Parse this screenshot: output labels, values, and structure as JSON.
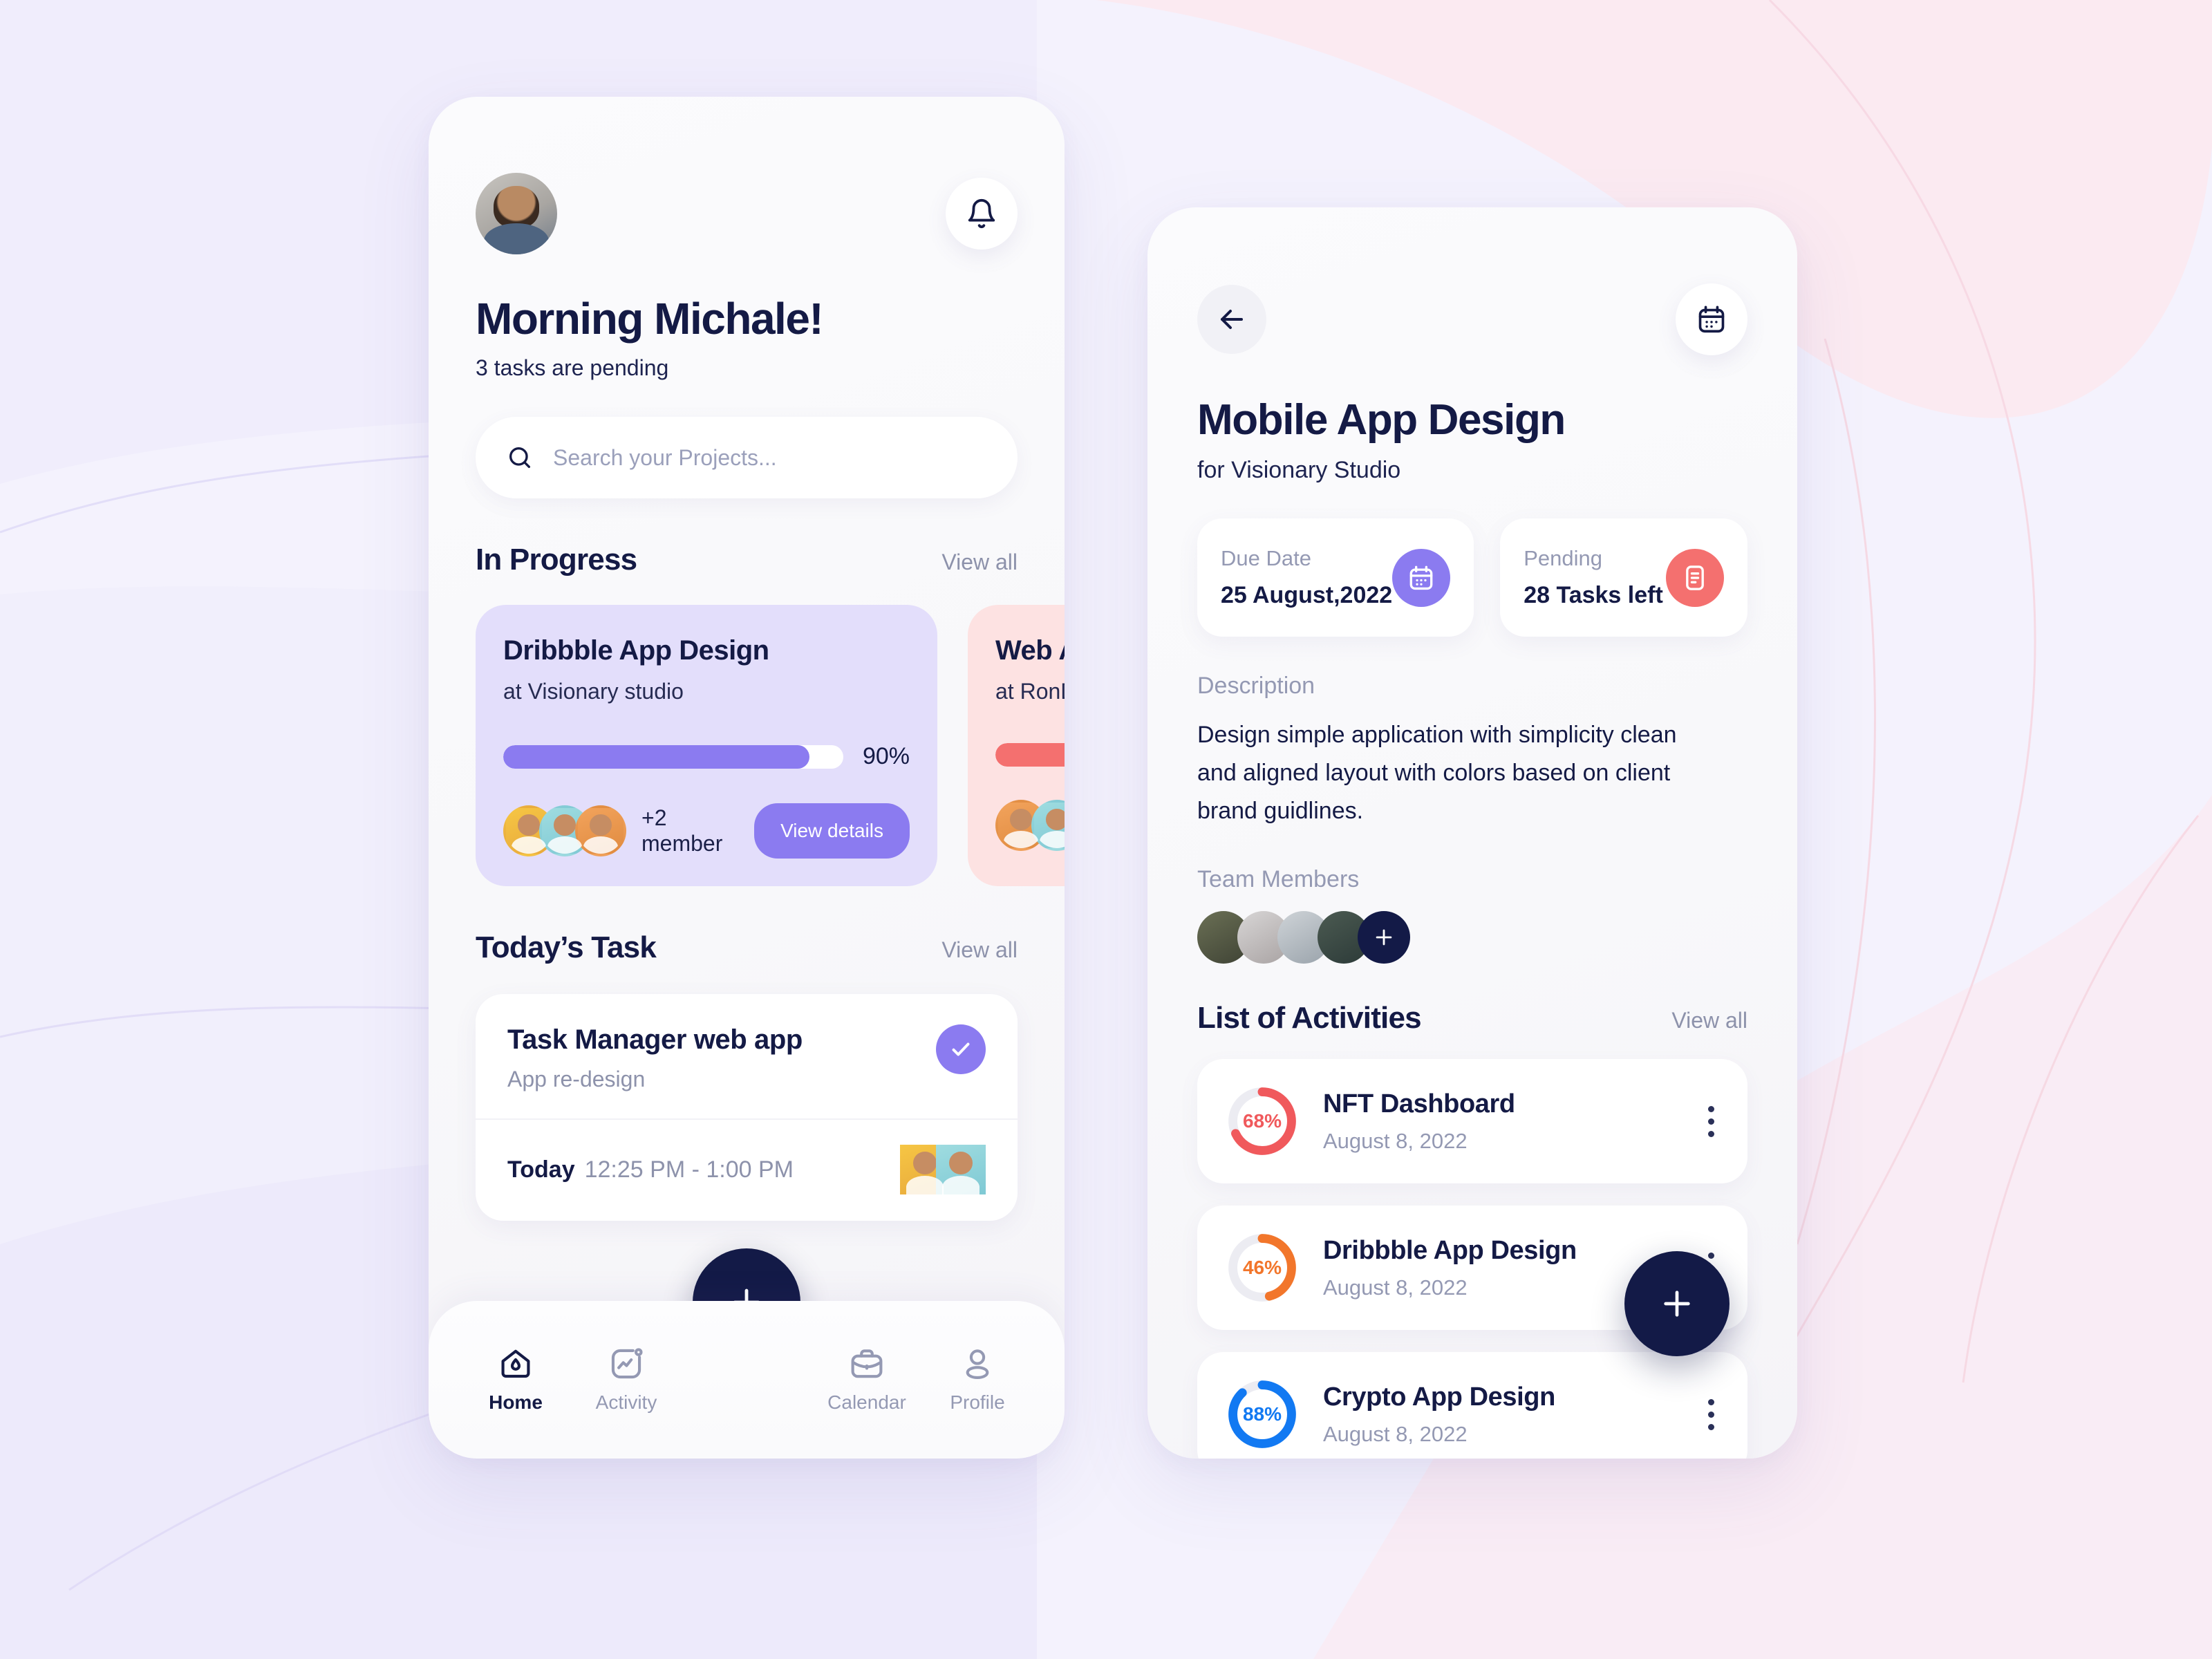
{
  "background": {
    "base_color": "#f4f2fd",
    "blob_pink": "#fbeaf1",
    "blob_lavender": "#efecfb"
  },
  "home_screen": {
    "avatar": "user-avatar",
    "notification_icon": "bell-icon",
    "greeting": "Morning Michale!",
    "pending_text": "3 tasks are pending",
    "search": {
      "placeholder": "Search your Projects...",
      "icon": "search-icon"
    },
    "in_progress": {
      "title": "In Progress",
      "view_all": "View all",
      "cards": [
        {
          "title": "Dribbble App Design",
          "subtitle": "at Visionary studio",
          "progress": 90,
          "progress_label": "90%",
          "members_text": "+2 member",
          "button_label": "View details",
          "accent": "#8b7bf0",
          "background": "#e3defb"
        },
        {
          "title": "Web App Design",
          "subtitle": "at RonDesign",
          "progress": 60,
          "progress_label": "",
          "members_text": "",
          "button_label": "",
          "accent": "#f4706f",
          "background": "#fde2e2"
        }
      ]
    },
    "todays_task": {
      "title": "Today’s Task",
      "view_all": "View all",
      "task": {
        "name": "Task Manager web app",
        "description": "App re-design",
        "completed_icon": "check-circle-icon",
        "day": "Today",
        "time_range": "12:25 PM - 1:00 PM"
      }
    },
    "fab": {
      "icon": "plus-icon",
      "color": "#131a47"
    },
    "bottom_nav": {
      "items": [
        {
          "label": "Home",
          "icon": "home-icon",
          "active": true
        },
        {
          "label": "Activity",
          "icon": "activity-chart-icon",
          "active": false
        },
        {
          "label": "Calendar",
          "icon": "briefcase-icon",
          "active": false
        },
        {
          "label": "Profile",
          "icon": "person-icon",
          "active": false
        }
      ]
    }
  },
  "detail_screen": {
    "back_icon": "arrow-left-icon",
    "calendar_icon": "calendar-icon",
    "title": "Mobile App Design",
    "subtitle": "for Visionary Studio",
    "stats": [
      {
        "label": "Due Date",
        "value": "25 August,2022",
        "icon": "calendar-icon",
        "icon_color": "#8b7bf0"
      },
      {
        "label": "Pending",
        "value": "28 Tasks left",
        "icon": "tasks-list-icon",
        "icon_color": "#f4706f"
      }
    ],
    "description_label": "Description",
    "description_text": "Design simple application with simplicity clean and aligned layout with colors based on client brand guidlines.",
    "team_label": "Team Members",
    "team_count": 4,
    "add_member_icon": "plus-icon",
    "activities": {
      "title": "List of Activities",
      "view_all": "View all",
      "items": [
        {
          "name": "NFT Dashboard",
          "date": "August 8, 2022",
          "percent": 68,
          "percent_label": "68%",
          "color": "#f0595c",
          "menu_icon": "more-vertical-icon"
        },
        {
          "name": "Dribbble App Design",
          "date": "August 8, 2022",
          "percent": 46,
          "percent_label": "46%",
          "color": "#f2762b",
          "menu_icon": "more-vertical-icon"
        },
        {
          "name": "Crypto App Design",
          "date": "August 8, 2022",
          "percent": 88,
          "percent_label": "88%",
          "color": "#1279f2",
          "menu_icon": "more-vertical-icon"
        }
      ]
    },
    "fab": {
      "icon": "plus-icon",
      "color": "#131a47"
    }
  }
}
